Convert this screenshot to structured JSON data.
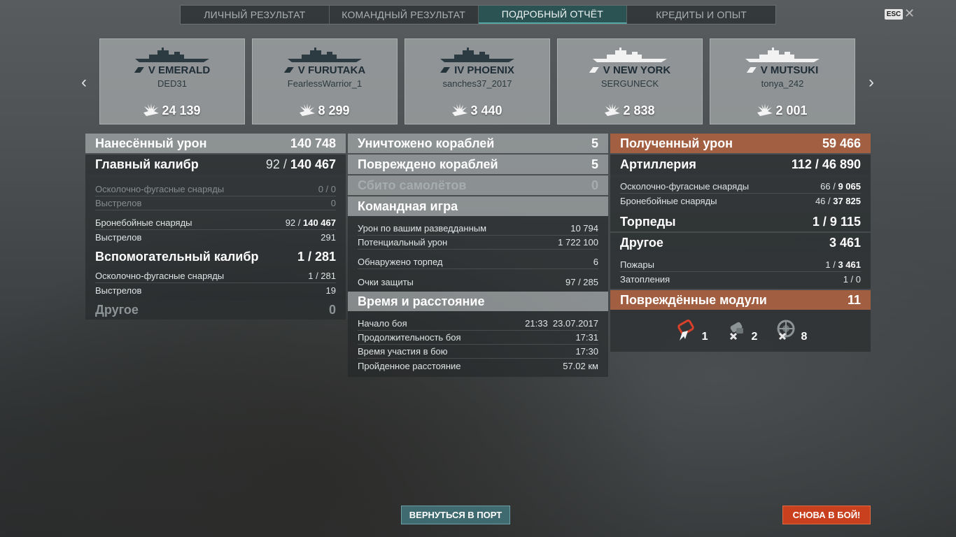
{
  "tabs": [
    {
      "label": "ЛИЧНЫЙ РЕЗУЛЬТАТ"
    },
    {
      "label": "КОМАНДНЫЙ РЕЗУЛЬТАТ"
    },
    {
      "label": "ПОДРОБНЫЙ ОТЧЁТ"
    },
    {
      "label": "КРЕДИТЫ И ОПЫТ"
    }
  ],
  "esc": "ESC",
  "close": "✕",
  "nav": {
    "prev": "‹",
    "next": "›"
  },
  "cards": [
    {
      "ship": "V EMERALD",
      "player": "DED31",
      "damage": "24 139",
      "ship_class": "cruiser",
      "icon": "ship-silhouette"
    },
    {
      "ship": "V FURUTAKA",
      "player": "FearlessWarrior_1",
      "damage": "8 299",
      "ship_class": "cruiser",
      "icon": "ship-silhouette"
    },
    {
      "ship": "IV PHOENIX",
      "player": "sanches37_2017",
      "damage": "3 440",
      "ship_class": "cruiser",
      "icon": "ship-silhouette"
    },
    {
      "ship": "V NEW YORK",
      "player": "SERGUNECK",
      "damage": "2 838",
      "ship_class": "battleship",
      "icon": "ship-silhouette"
    },
    {
      "ship": "V MUTSUKI",
      "player": "tonya_242",
      "damage": "2 001",
      "ship_class": "destroyer",
      "icon": "ship-silhouette"
    }
  ],
  "dealt": {
    "title": "Нанесённый урон",
    "total": "140 748",
    "main": {
      "title": "Главный калибр",
      "hits": "92",
      "sep": "/",
      "dmg": "140 467",
      "he": {
        "label": "Осколочно-фугасные снаряды",
        "value": "0 / 0"
      },
      "he_shots": {
        "label": "Выстрелов",
        "value": "0"
      },
      "ap": {
        "label": "Бронебойные снаряды",
        "hits": "92 / ",
        "dmg": "140 467"
      },
      "ap_shots": {
        "label": "Выстрелов",
        "value": "291"
      }
    },
    "secondary": {
      "title": "Вспомогательный калибр",
      "value": "1 / 281",
      "he": {
        "label": "Осколочно-фугасные снаряды",
        "value": "1 / 281"
      },
      "shots": {
        "label": "Выстрелов",
        "value": "19"
      }
    },
    "other": {
      "title": "Другое",
      "value": "0"
    }
  },
  "center": {
    "destroyed": {
      "label": "Уничтожено кораблей",
      "value": "5"
    },
    "damaged": {
      "label": "Повреждено кораблей",
      "value": "5"
    },
    "planes": {
      "label": "Сбито самолётов",
      "value": "0"
    },
    "team": {
      "title": "Командная игра",
      "rows": [
        {
          "label": "Урон по вашим разведданным",
          "value": "10 794"
        },
        {
          "label": "Потенциальный урон",
          "value": "1 722 100"
        },
        {
          "label": "Обнаружено торпед",
          "value": "6"
        },
        {
          "label": "Очки защиты",
          "value": "97 / 285"
        }
      ]
    },
    "time": {
      "title": "Время и расстояние",
      "rows": [
        {
          "label": "Начало боя",
          "value": "21:33  23.07.2017"
        },
        {
          "label": "Продолжительность боя",
          "value": "17:31"
        },
        {
          "label": "Время участия в бою",
          "value": "17:30"
        },
        {
          "label": "Пройденное расстояние",
          "value": "57.02 км"
        }
      ]
    }
  },
  "received": {
    "title": "Полученный урон",
    "total": "59 466",
    "artillery": {
      "title": "Артиллерия",
      "value": "112 / 46 890",
      "he": {
        "label": "Осколочно-фугасные снаряды",
        "hits": "66 / ",
        "dmg": "9 065"
      },
      "ap": {
        "label": "Бронебойные снаряды",
        "hits": "46 / ",
        "dmg": "37 825"
      }
    },
    "torpedoes": {
      "title": "Торпеды",
      "value": "1 / 9 115"
    },
    "other": {
      "title": "Другое",
      "value": "3 461",
      "fires": {
        "label": "Пожары",
        "hits": "1 / ",
        "dmg": "3 461"
      },
      "flooding": {
        "label": "Затопления",
        "value": "1 / 0"
      }
    },
    "modules": {
      "title": "Повреждённые модули",
      "value": "11",
      "items": [
        {
          "icon": "engine-icon",
          "count": "1"
        },
        {
          "icon": "steering-gear-icon",
          "count": "2"
        },
        {
          "icon": "gun-turret-icon",
          "count": "8"
        }
      ]
    }
  },
  "buttons": {
    "port": "ВЕРНУТЬСЯ В ПОРТ",
    "battle": "СНОВА В БОЙ!"
  },
  "colors": {
    "accent_teal": "#2b5353",
    "orange": "#b2623e",
    "battle_red": "#c8401e"
  }
}
